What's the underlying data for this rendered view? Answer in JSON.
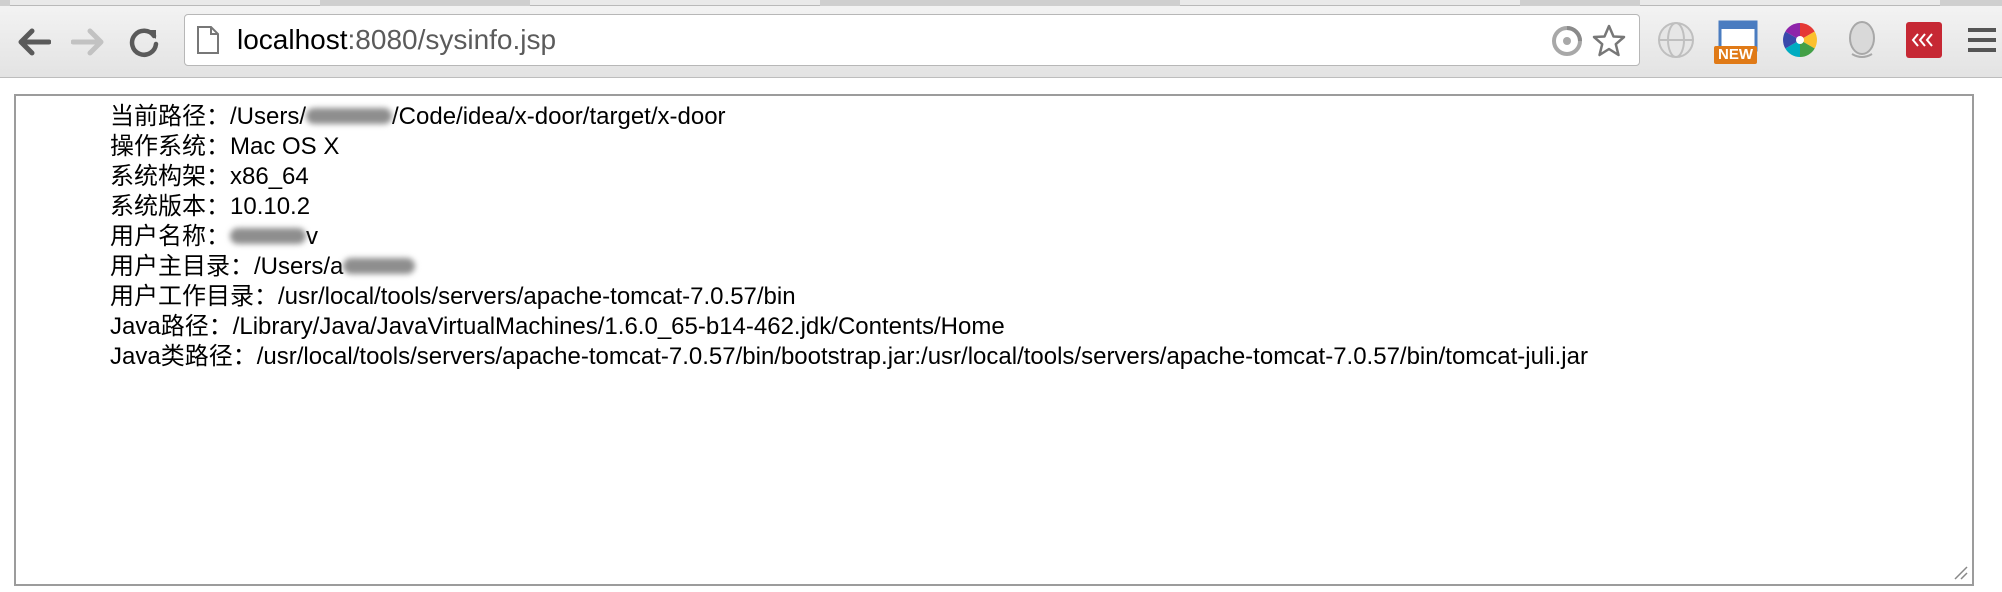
{
  "toolbar": {
    "back_icon": "back-arrow-icon",
    "forward_icon": "forward-arrow-icon",
    "reload_icon": "reload-icon",
    "url": {
      "host": "localhost",
      "rest": ":8080/sysinfo.jsp"
    },
    "extensions": [
      {
        "name": "globe-extension-icon"
      },
      {
        "name": "new-window-extension-icon",
        "badge": "NEW"
      },
      {
        "name": "color-wheel-extension-icon"
      },
      {
        "name": "profile-head-extension-icon"
      },
      {
        "name": "red-arrows-extension-icon"
      }
    ],
    "menu_icon": "hamburger-menu-icon"
  },
  "sysinfo": {
    "lines": [
      {
        "label": "当前路径：",
        "before": "/Users/",
        "after": "/Code/idea/x-door/target/x-door"
      },
      {
        "label": "操作系统：",
        "value": "Mac OS X"
      },
      {
        "label": "系统构架：",
        "value": "x86_64"
      },
      {
        "label": "系统版本：",
        "value": "10.10.2"
      },
      {
        "label": "用户名称：",
        "after": "v"
      },
      {
        "label": "用户主目录：",
        "before": "/Users/a"
      },
      {
        "label": "用户工作目录：",
        "value": "/usr/local/tools/servers/apache-tomcat-7.0.57/bin"
      },
      {
        "label": "Java路径：",
        "value": "/Library/Java/JavaVirtualMachines/1.6.0_65-b14-462.jdk/Contents/Home"
      },
      {
        "label": "Java类路径：",
        "value": "/usr/local/tools/servers/apache-tomcat-7.0.57/bin/bootstrap.jar:/usr/local/tools/servers/apache-tomcat-7.0.57/bin/tomcat-juli.jar"
      }
    ]
  }
}
